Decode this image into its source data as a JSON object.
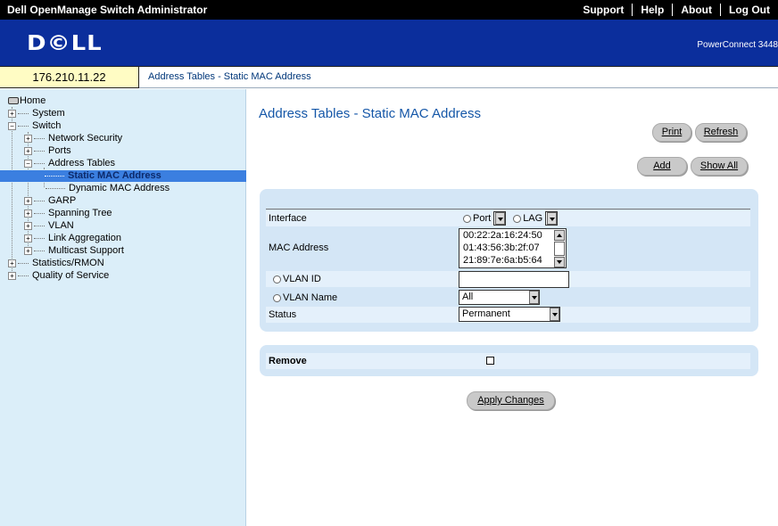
{
  "topbar": {
    "title": "Dell OpenManage Switch Administrator",
    "links": [
      "Support",
      "Help",
      "About",
      "Log Out"
    ]
  },
  "banner": {
    "logo": "D©LL",
    "model": "PowerConnect 3448"
  },
  "address": {
    "ip": "176.210.11.22",
    "breadcrumb": "Address Tables - Static MAC Address"
  },
  "tree": {
    "home": "Home",
    "system": "System",
    "switch": "Switch",
    "network_security": "Network Security",
    "ports": "Ports",
    "address_tables": "Address Tables",
    "static_mac": "Static MAC Address",
    "dynamic_mac": "Dynamic MAC Address",
    "garp": "GARP",
    "spanning_tree": "Spanning Tree",
    "vlan": "VLAN",
    "link_aggregation": "Link Aggregation",
    "multicast_support": "Multicast Support",
    "statistics": "Statistics/RMON",
    "qos": "Quality of Service"
  },
  "main": {
    "title": "Address Tables - Static MAC Address",
    "print_label": "Print",
    "refresh_label": "Refresh",
    "add_label": "Add",
    "show_all_label": "Show All",
    "apply_label": "Apply Changes"
  },
  "form": {
    "interface_label": "Interface",
    "port_label": "Port",
    "lag_label": "LAG",
    "mac_label": "MAC Address",
    "mac_options": [
      "00:22:2a:16:24:50",
      "01:43:56:3b:2f:07",
      "21:89:7e:6a:b5:64"
    ],
    "vlan_id_label": "VLAN ID",
    "vlan_id_value": "",
    "vlan_name_label": "VLAN Name",
    "vlan_name_value": "All",
    "status_label": "Status",
    "status_value": "Permanent",
    "remove_label": "Remove",
    "remove_checked": false
  },
  "colors": {
    "banner": "#0b2e9c",
    "tree_bg": "#dbeef9",
    "panel_bg": "#d4e6f6",
    "title": "#1557a8"
  }
}
